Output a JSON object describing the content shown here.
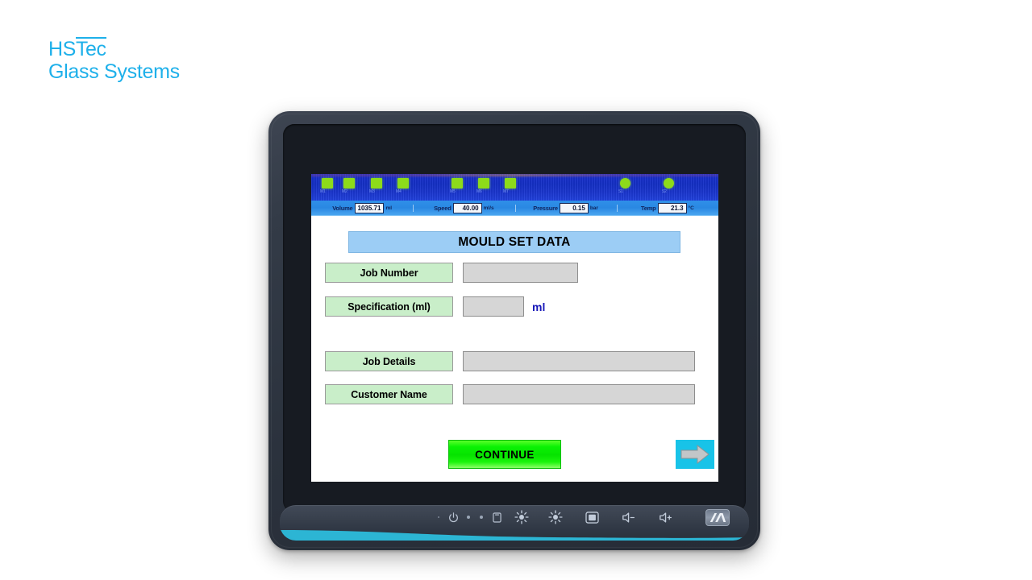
{
  "brand": {
    "line1_prefix": "HS",
    "line1_overlined": "Tec",
    "line2": "Glass Systems"
  },
  "hmi": {
    "statusbar": {
      "indicators": [
        {
          "shape": "square",
          "color": "#8ddb1a",
          "label": "M1"
        },
        {
          "shape": "square",
          "color": "#8ddb1a",
          "label": "M2"
        },
        {
          "shape": "square",
          "color": "#8ddb1a",
          "label": "M3"
        },
        {
          "shape": "square",
          "color": "#8ddb1a",
          "label": "M4"
        },
        {
          "shape": "square",
          "color": "#8ddb1a",
          "label": "M5"
        },
        {
          "shape": "square",
          "color": "#8ddb1a",
          "label": "M6"
        },
        {
          "shape": "square",
          "color": "#8ddb1a",
          "label": "M7"
        },
        {
          "shape": "circle",
          "color": "#8ddb1a",
          "label": "S1"
        },
        {
          "shape": "circle",
          "color": "#8ddb1a",
          "label": "S2"
        }
      ],
      "readouts": [
        {
          "name": "Volume",
          "value": "1035.71",
          "unit": "ml"
        },
        {
          "name": "Speed",
          "value": "40.00",
          "unit": "ml/s"
        },
        {
          "name": "Pressure",
          "value": "0.15",
          "unit": "bar"
        },
        {
          "name": "Temp",
          "value": "21.3",
          "unit": "°C"
        }
      ]
    },
    "title": "MOULD SET DATA",
    "fields": [
      {
        "label": "Job Number",
        "value": "",
        "unit": ""
      },
      {
        "label": "Specification (ml)",
        "value": "",
        "unit": "ml"
      },
      {
        "label": "Job Details",
        "value": "",
        "unit": ""
      },
      {
        "label": "Customer Name",
        "value": "",
        "unit": ""
      }
    ],
    "continue_label": "CONTINUE",
    "next_arrow_icon": "arrow-right-icon",
    "colors": {
      "title_banner": "#9ccdf5",
      "field_label": "#c9eec9",
      "field_input": "#d6d6d6",
      "continue": "#0bf204",
      "arrow_bg": "#18c3e8",
      "unit_text": "#1717b8",
      "topbar": "#1430c6",
      "readout_bar": "#2a88e2",
      "brand": "#1eb0ea"
    }
  },
  "bezel": {
    "icons": [
      {
        "name": "status-dot-icon"
      },
      {
        "name": "power-icon"
      },
      {
        "name": "led-indicator-icon"
      },
      {
        "name": "led-indicator-icon"
      },
      {
        "name": "menu-square-icon"
      },
      {
        "name": "brightness-up-icon"
      },
      {
        "name": "brightness-down-icon"
      },
      {
        "name": "display-icon"
      },
      {
        "name": "volume-down-icon"
      },
      {
        "name": "volume-up-icon"
      },
      {
        "name": "manufacturer-logo-icon"
      }
    ],
    "accent_color": "#2cb5d4"
  }
}
